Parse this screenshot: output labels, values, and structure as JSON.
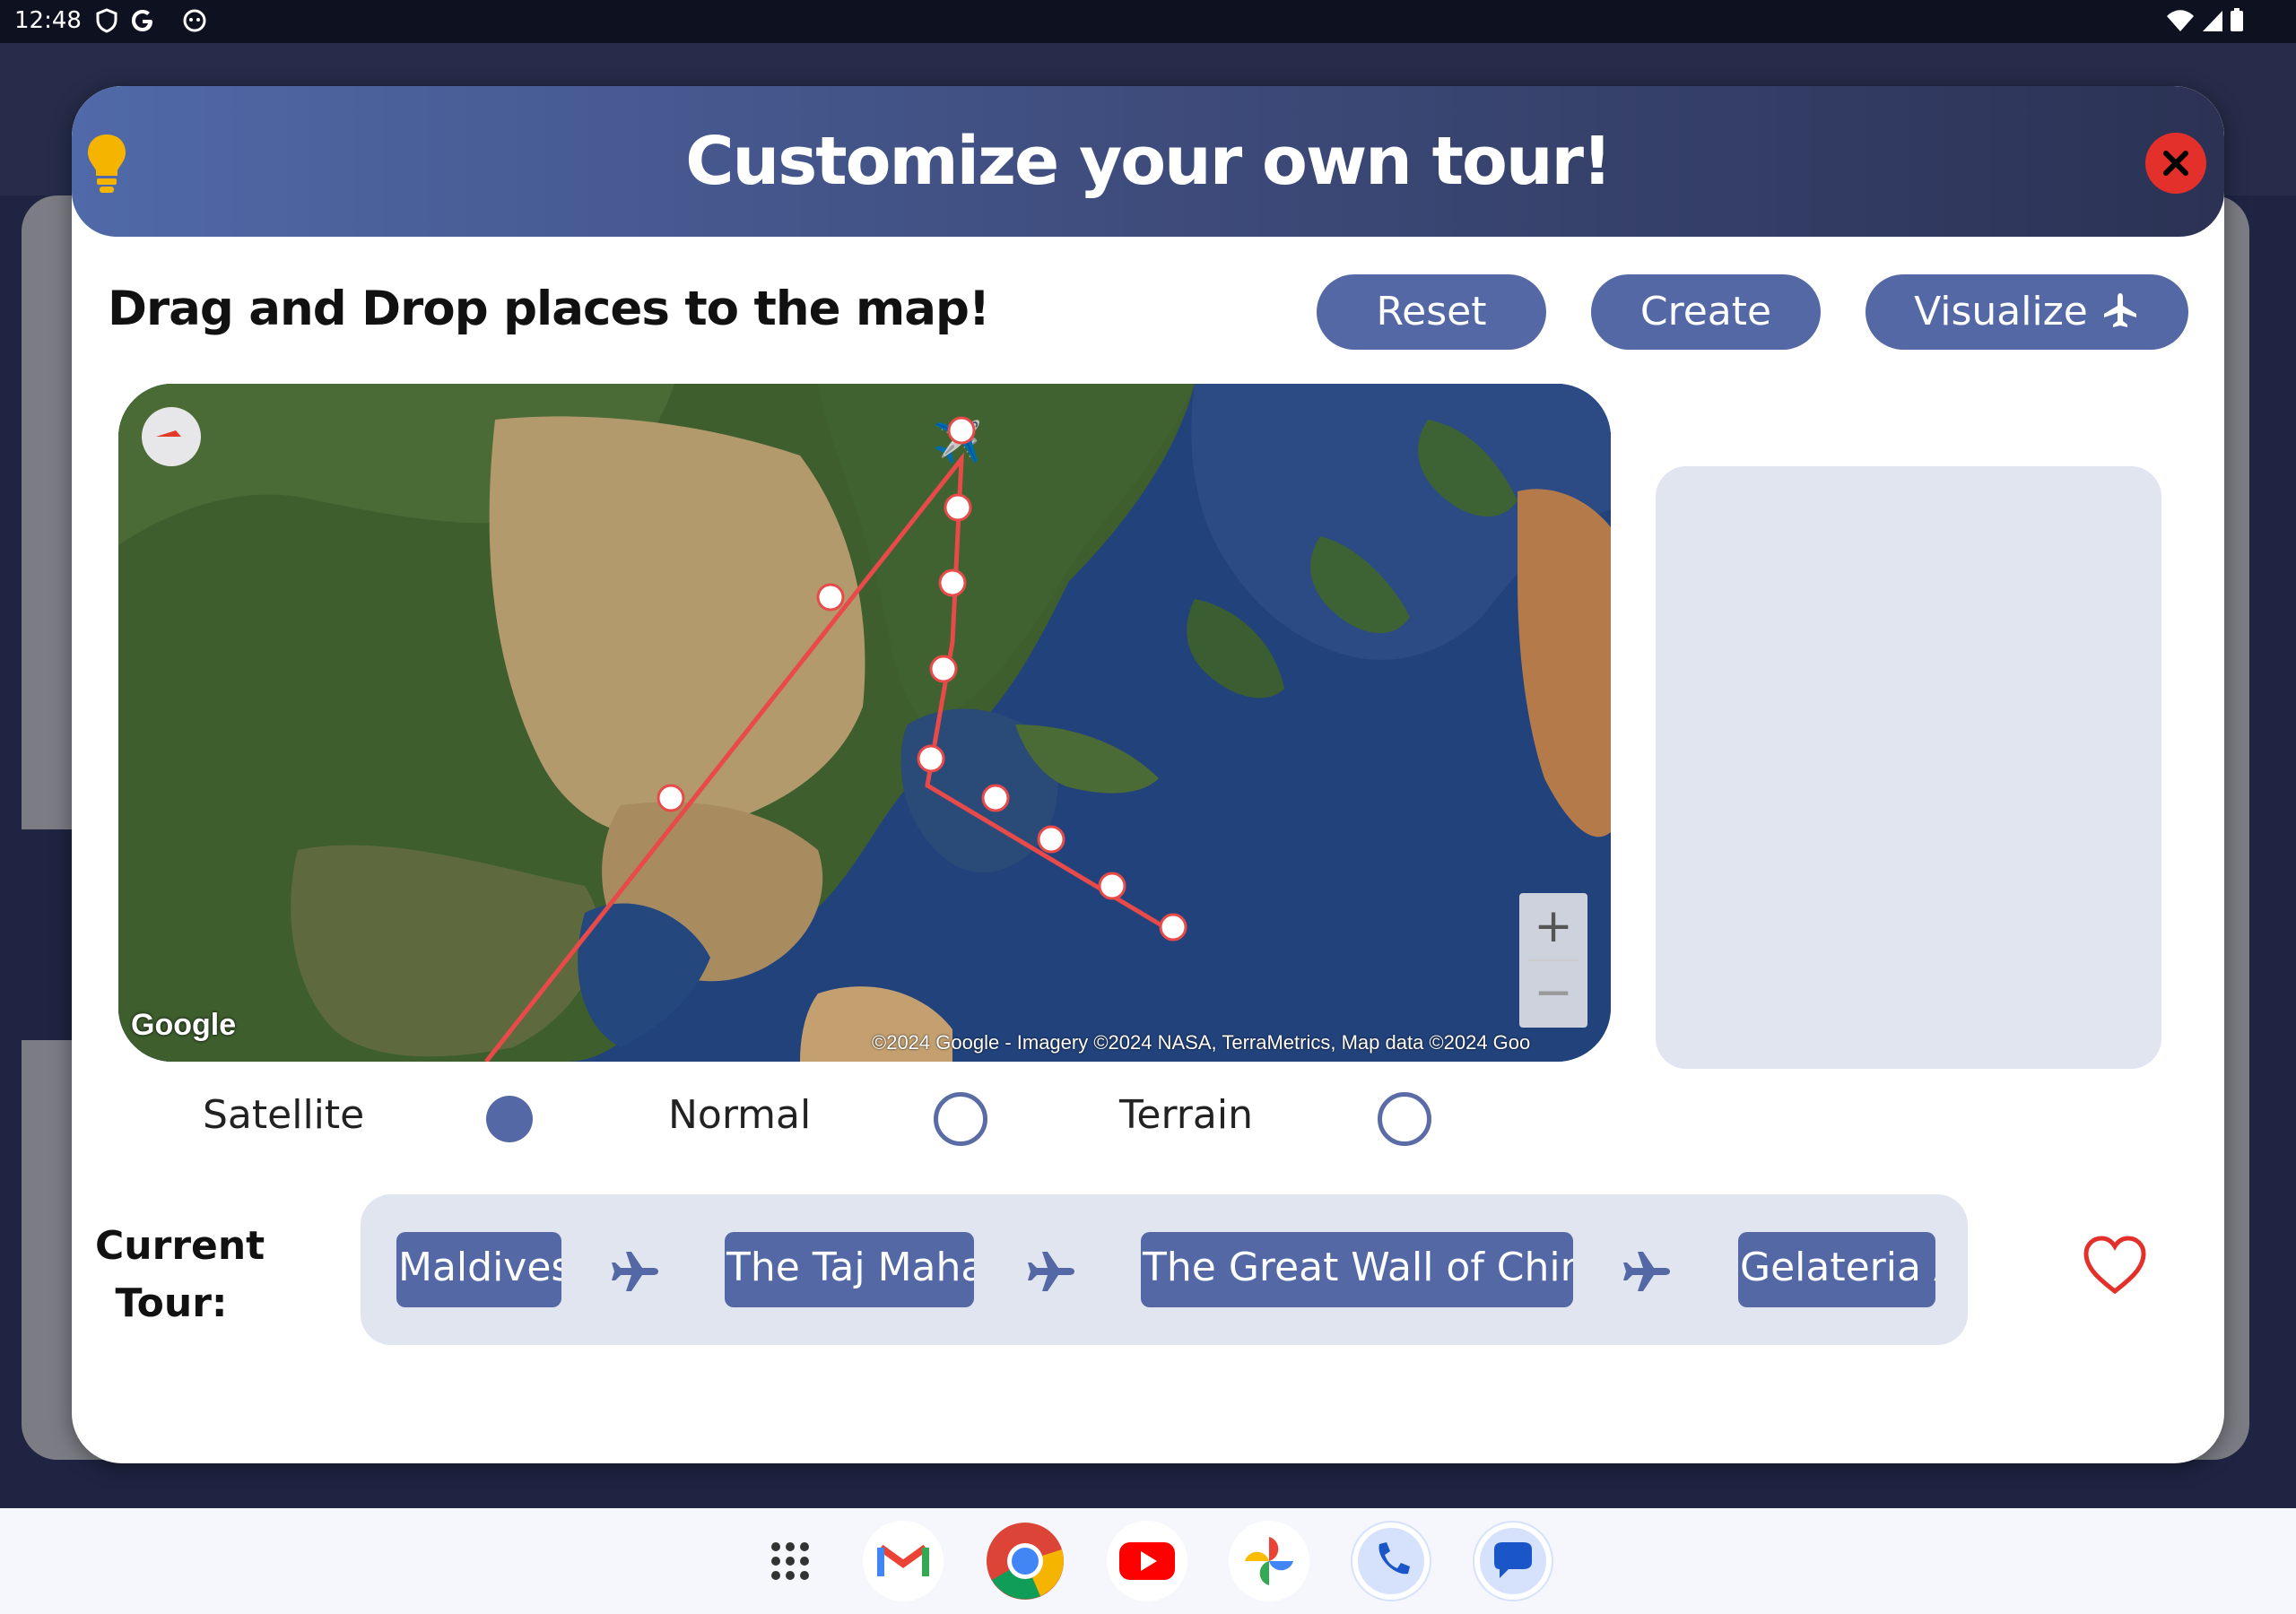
{
  "status_bar": {
    "time": "12:48"
  },
  "dialog": {
    "title": "Customize your own tour!",
    "instruction": "Drag and Drop places to the map!",
    "buttons": {
      "reset": "Reset",
      "create": "Create",
      "visualize": "Visualize"
    }
  },
  "map": {
    "logo": "Google",
    "attribution": "©2024 Google - Imagery ©2024 NASA, TerraMetrics, Map data ©2024 Goo",
    "zoom_in": "+",
    "zoom_out": "−",
    "route_color": "#e84a4a"
  },
  "map_types": [
    {
      "label": "Satellite",
      "selected": true
    },
    {
      "label": "Normal",
      "selected": false
    },
    {
      "label": "Terrain",
      "selected": false
    }
  ],
  "current_tour": {
    "label": "Current Tour:",
    "stops": [
      "Maldives",
      "The Taj Mahal",
      "The Great Wall of China",
      "Gelateria A"
    ]
  },
  "colors": {
    "accent": "#5468a6",
    "close": "#e3302a",
    "favorite": "#e3302a",
    "panel": "#e1e5ef"
  },
  "icons": [
    "lightbulb-icon",
    "close-icon",
    "airplane-icon",
    "compass-icon",
    "heart-icon"
  ],
  "taskbar_apps": [
    "app-drawer",
    "gmail",
    "chrome",
    "youtube",
    "photos",
    "phone",
    "messages"
  ]
}
